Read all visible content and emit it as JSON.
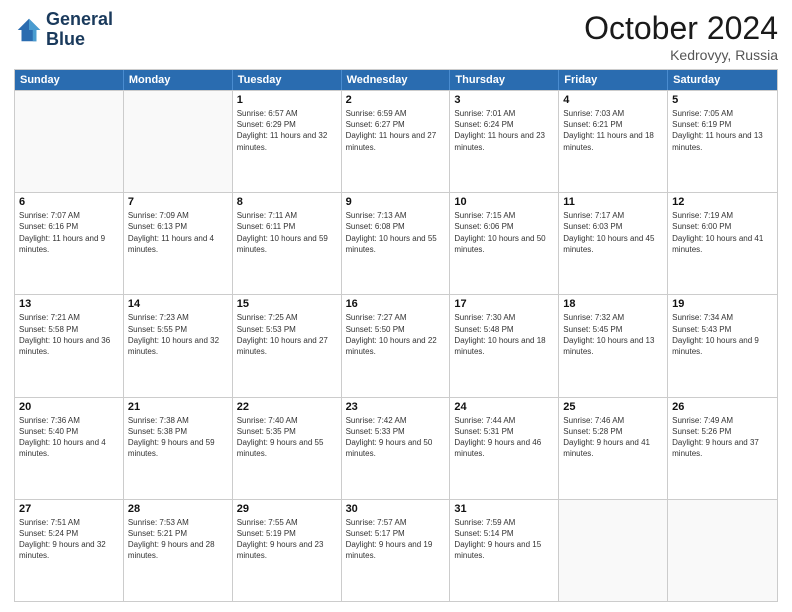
{
  "header": {
    "logo_line1": "General",
    "logo_line2": "Blue",
    "month": "October 2024",
    "location": "Kedrovyy, Russia"
  },
  "weekdays": [
    "Sunday",
    "Monday",
    "Tuesday",
    "Wednesday",
    "Thursday",
    "Friday",
    "Saturday"
  ],
  "rows": [
    [
      {
        "day": "",
        "info": ""
      },
      {
        "day": "",
        "info": ""
      },
      {
        "day": "1",
        "info": "Sunrise: 6:57 AM\nSunset: 6:29 PM\nDaylight: 11 hours and 32 minutes."
      },
      {
        "day": "2",
        "info": "Sunrise: 6:59 AM\nSunset: 6:27 PM\nDaylight: 11 hours and 27 minutes."
      },
      {
        "day": "3",
        "info": "Sunrise: 7:01 AM\nSunset: 6:24 PM\nDaylight: 11 hours and 23 minutes."
      },
      {
        "day": "4",
        "info": "Sunrise: 7:03 AM\nSunset: 6:21 PM\nDaylight: 11 hours and 18 minutes."
      },
      {
        "day": "5",
        "info": "Sunrise: 7:05 AM\nSunset: 6:19 PM\nDaylight: 11 hours and 13 minutes."
      }
    ],
    [
      {
        "day": "6",
        "info": "Sunrise: 7:07 AM\nSunset: 6:16 PM\nDaylight: 11 hours and 9 minutes."
      },
      {
        "day": "7",
        "info": "Sunrise: 7:09 AM\nSunset: 6:13 PM\nDaylight: 11 hours and 4 minutes."
      },
      {
        "day": "8",
        "info": "Sunrise: 7:11 AM\nSunset: 6:11 PM\nDaylight: 10 hours and 59 minutes."
      },
      {
        "day": "9",
        "info": "Sunrise: 7:13 AM\nSunset: 6:08 PM\nDaylight: 10 hours and 55 minutes."
      },
      {
        "day": "10",
        "info": "Sunrise: 7:15 AM\nSunset: 6:06 PM\nDaylight: 10 hours and 50 minutes."
      },
      {
        "day": "11",
        "info": "Sunrise: 7:17 AM\nSunset: 6:03 PM\nDaylight: 10 hours and 45 minutes."
      },
      {
        "day": "12",
        "info": "Sunrise: 7:19 AM\nSunset: 6:00 PM\nDaylight: 10 hours and 41 minutes."
      }
    ],
    [
      {
        "day": "13",
        "info": "Sunrise: 7:21 AM\nSunset: 5:58 PM\nDaylight: 10 hours and 36 minutes."
      },
      {
        "day": "14",
        "info": "Sunrise: 7:23 AM\nSunset: 5:55 PM\nDaylight: 10 hours and 32 minutes."
      },
      {
        "day": "15",
        "info": "Sunrise: 7:25 AM\nSunset: 5:53 PM\nDaylight: 10 hours and 27 minutes."
      },
      {
        "day": "16",
        "info": "Sunrise: 7:27 AM\nSunset: 5:50 PM\nDaylight: 10 hours and 22 minutes."
      },
      {
        "day": "17",
        "info": "Sunrise: 7:30 AM\nSunset: 5:48 PM\nDaylight: 10 hours and 18 minutes."
      },
      {
        "day": "18",
        "info": "Sunrise: 7:32 AM\nSunset: 5:45 PM\nDaylight: 10 hours and 13 minutes."
      },
      {
        "day": "19",
        "info": "Sunrise: 7:34 AM\nSunset: 5:43 PM\nDaylight: 10 hours and 9 minutes."
      }
    ],
    [
      {
        "day": "20",
        "info": "Sunrise: 7:36 AM\nSunset: 5:40 PM\nDaylight: 10 hours and 4 minutes."
      },
      {
        "day": "21",
        "info": "Sunrise: 7:38 AM\nSunset: 5:38 PM\nDaylight: 9 hours and 59 minutes."
      },
      {
        "day": "22",
        "info": "Sunrise: 7:40 AM\nSunset: 5:35 PM\nDaylight: 9 hours and 55 minutes."
      },
      {
        "day": "23",
        "info": "Sunrise: 7:42 AM\nSunset: 5:33 PM\nDaylight: 9 hours and 50 minutes."
      },
      {
        "day": "24",
        "info": "Sunrise: 7:44 AM\nSunset: 5:31 PM\nDaylight: 9 hours and 46 minutes."
      },
      {
        "day": "25",
        "info": "Sunrise: 7:46 AM\nSunset: 5:28 PM\nDaylight: 9 hours and 41 minutes."
      },
      {
        "day": "26",
        "info": "Sunrise: 7:49 AM\nSunset: 5:26 PM\nDaylight: 9 hours and 37 minutes."
      }
    ],
    [
      {
        "day": "27",
        "info": "Sunrise: 7:51 AM\nSunset: 5:24 PM\nDaylight: 9 hours and 32 minutes."
      },
      {
        "day": "28",
        "info": "Sunrise: 7:53 AM\nSunset: 5:21 PM\nDaylight: 9 hours and 28 minutes."
      },
      {
        "day": "29",
        "info": "Sunrise: 7:55 AM\nSunset: 5:19 PM\nDaylight: 9 hours and 23 minutes."
      },
      {
        "day": "30",
        "info": "Sunrise: 7:57 AM\nSunset: 5:17 PM\nDaylight: 9 hours and 19 minutes."
      },
      {
        "day": "31",
        "info": "Sunrise: 7:59 AM\nSunset: 5:14 PM\nDaylight: 9 hours and 15 minutes."
      },
      {
        "day": "",
        "info": ""
      },
      {
        "day": "",
        "info": ""
      }
    ]
  ]
}
